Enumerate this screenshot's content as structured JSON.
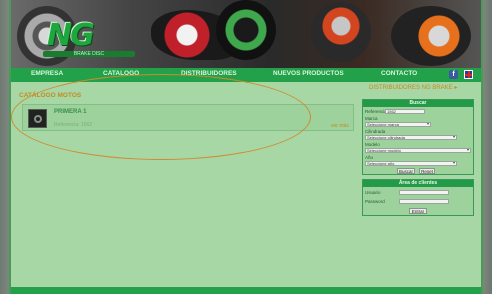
{
  "header": {
    "logo_text": "NG",
    "logo_subtitle": "BRAKE DISC"
  },
  "nav": {
    "items": [
      "EMPRESA",
      "CATALOGO",
      "DISTRIBUIDORES",
      "NUEVOS PRODUCTOS",
      "CONTACTO"
    ],
    "facebook_icon": "f",
    "language_icon": "uk-flag-icon"
  },
  "main": {
    "section_title": "CATÁLOGO MOTOS",
    "top_link": "DISTRIBUIDORES NG BRAKE ▸",
    "product": {
      "name": "PRIMERA 1",
      "subtitle": "Referencia: 1562",
      "link": "ver más"
    }
  },
  "search_panel": {
    "title": "Buscar",
    "reference_label": "Referencia",
    "reference_value": "1562",
    "brand_label": "Marca",
    "brand_value": "Seleccione marca",
    "cylinder_label": "Cilindrada",
    "cylinder_value": "Seleccione cilindrada",
    "model_label": "Modelo",
    "model_value": "Seleccione modelo",
    "year_label": "Año",
    "year_value": "Seleccione año",
    "search_button": "Buscar",
    "reset_button": "Reset"
  },
  "login_panel": {
    "title": "Área de clientes",
    "user_label": "Usuario",
    "password_label": "Password",
    "submit_button": "Entrar"
  }
}
